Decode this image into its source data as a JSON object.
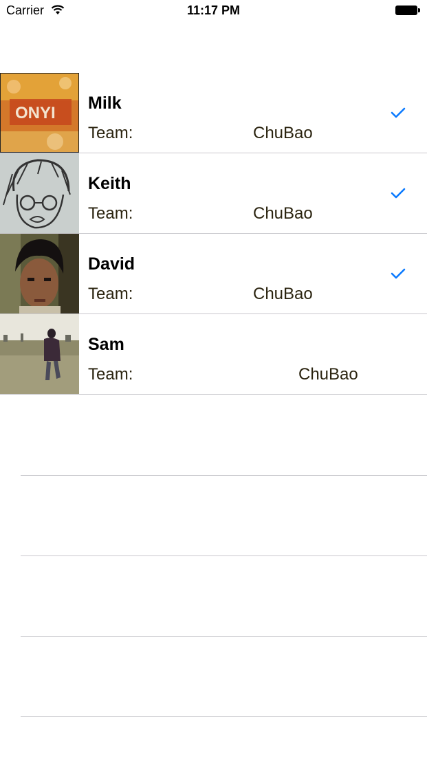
{
  "status_bar": {
    "carrier": "Carrier",
    "time": "11:17 PM",
    "wifi_icon": "wifi-icon",
    "battery_icon": "battery-icon"
  },
  "members": [
    {
      "name": "Milk",
      "team_label": "Team:",
      "team": "ChuBao",
      "checked": true
    },
    {
      "name": "Keith",
      "team_label": "Team:",
      "team": "ChuBao",
      "checked": true
    },
    {
      "name": "David",
      "team_label": "Team:",
      "team": "ChuBao",
      "checked": true
    },
    {
      "name": "Sam",
      "team_label": "Team:",
      "team": "ChuBao",
      "checked": false
    }
  ],
  "colors": {
    "checkmark": "#0a7aff",
    "separator": "#c8c7cc",
    "team_text": "#2b2410"
  }
}
